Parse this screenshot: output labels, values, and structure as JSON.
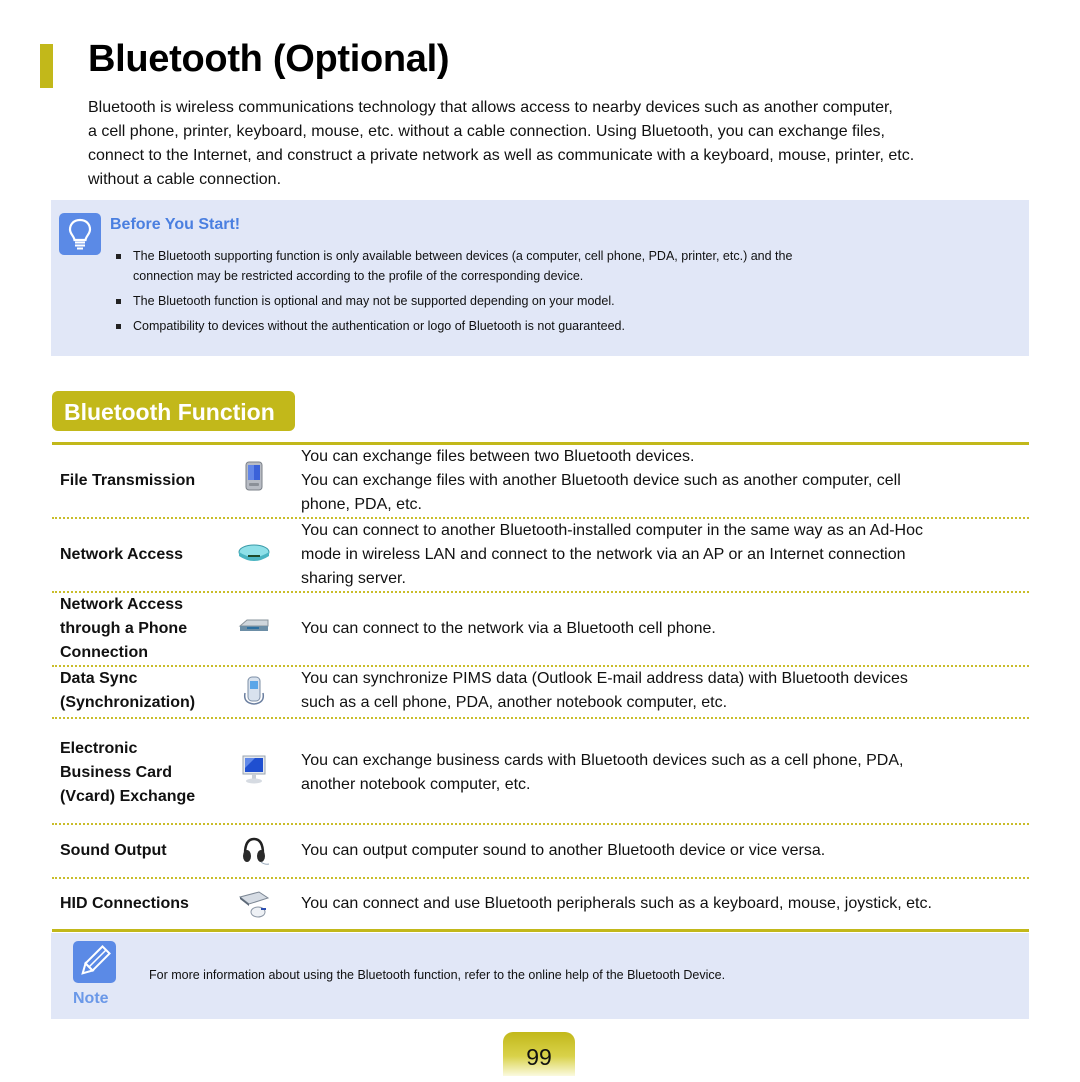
{
  "page": {
    "title": "Bluetooth (Optional)",
    "intro_lines": [
      "Bluetooth is wireless communications technology that allows access to nearby devices such as another computer,",
      "a cell phone, printer, keyboard, mouse, etc. without a cable connection. Using Bluetooth, you can exchange files,",
      "connect to the Internet, and construct a private network as well as communicate with a keyboard, mouse, printer, etc.",
      "without a cable connection."
    ],
    "page_number": "99"
  },
  "before_you_start": {
    "icon": "lightbulb-icon",
    "title": "Before You Start!",
    "items": [
      "The Bluetooth supporting function is only available between devices (a computer, cell phone, PDA, printer, etc.) and the",
      "connection may be restricted according to the profile of the corresponding device.",
      "The Bluetooth function is optional and may not be supported depending on your model.",
      "Compatibility to devices without the authentication or logo of Bluetooth is not guaranteed."
    ]
  },
  "section": {
    "title": "Bluetooth Function",
    "rows": [
      {
        "name_lines": [
          "File Transmission"
        ],
        "icon": "pda-icon",
        "desc_lines": [
          "You can exchange files between two Bluetooth devices.",
          "You can exchange files with another Bluetooth device such as another computer, cell",
          "phone, PDA, etc."
        ]
      },
      {
        "name_lines": [
          "Network Access"
        ],
        "icon": "router-icon",
        "desc_lines": [
          "You can connect to another Bluetooth-installed computer in the same way as an Ad-Hoc",
          "mode in wireless LAN and connect to the network via an AP or an Internet connection",
          "sharing server."
        ]
      },
      {
        "name_lines": [
          "Network Access",
          "through a Phone",
          "Connection"
        ],
        "icon": "modem-icon",
        "desc_lines": [
          "You can connect to the network via a Bluetooth cell phone."
        ]
      },
      {
        "name_lines": [
          "Data Sync",
          "(Synchronization)"
        ],
        "icon": "cell-phone-icon",
        "desc_lines": [
          "You can synchronize PIMS data (Outlook E-mail address data) with Bluetooth devices",
          "such as a cell phone, PDA, another notebook computer, etc."
        ]
      },
      {
        "name_lines": [
          "Electronic",
          "Business Card",
          "(Vcard) Exchange"
        ],
        "icon": "monitor-icon",
        "desc_lines": [
          "You can exchange business cards with Bluetooth devices such as a cell phone, PDA,",
          "another notebook computer, etc."
        ]
      },
      {
        "name_lines": [
          "Sound Output"
        ],
        "icon": "headphones-icon",
        "desc_lines": [
          "You can output computer sound to another Bluetooth device or vice versa."
        ]
      },
      {
        "name_lines": [
          "HID Connections"
        ],
        "icon": "keyboard-mouse-icon",
        "desc_lines": [
          "You can connect and use Bluetooth peripherals such as a keyboard, mouse, joystick, etc."
        ]
      }
    ]
  },
  "note": {
    "icon": "pencil-icon",
    "label": "Note",
    "text": "For more information about using the Bluetooth function, refer to the online help of the Bluetooth Device."
  },
  "colors": {
    "accent": "#c2b81a",
    "info_box": "#e1e7f7",
    "info_icon": "#5b8ae6",
    "info_title": "#4a7fe0"
  }
}
